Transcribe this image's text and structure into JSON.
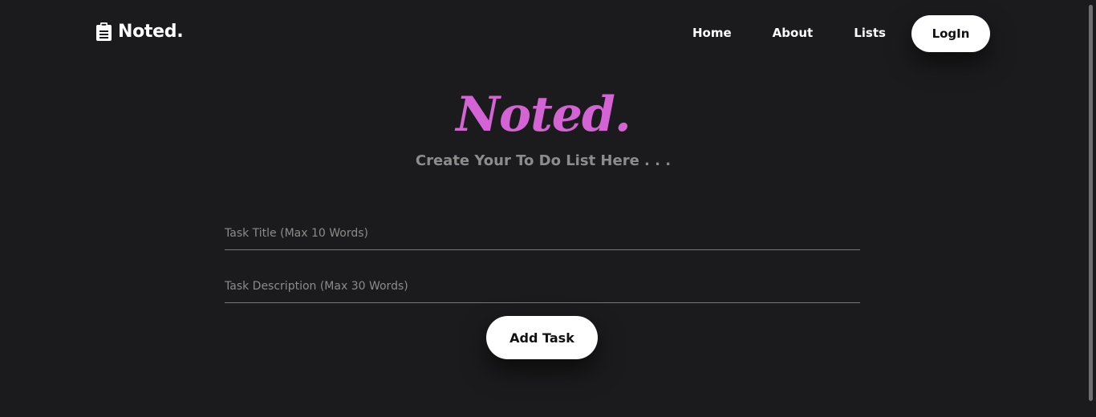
{
  "nav": {
    "brand": "Noted.",
    "brand_icon": "clipboard-list-icon",
    "links": [
      {
        "label": "Home"
      },
      {
        "label": "About"
      },
      {
        "label": "Lists"
      }
    ],
    "login_label": "LogIn"
  },
  "hero": {
    "title": "Noted.",
    "subtitle": "Create Your To Do List Here . . ."
  },
  "form": {
    "title_placeholder": "Task Title (Max 10 Words)",
    "description_placeholder": "Task Description (Max 30 Words)",
    "title_value": "",
    "description_value": "",
    "submit_label": "Add Task"
  },
  "colors": {
    "background": "#1b1b1d",
    "accent": "#d463d4",
    "button": "#ffffff"
  }
}
